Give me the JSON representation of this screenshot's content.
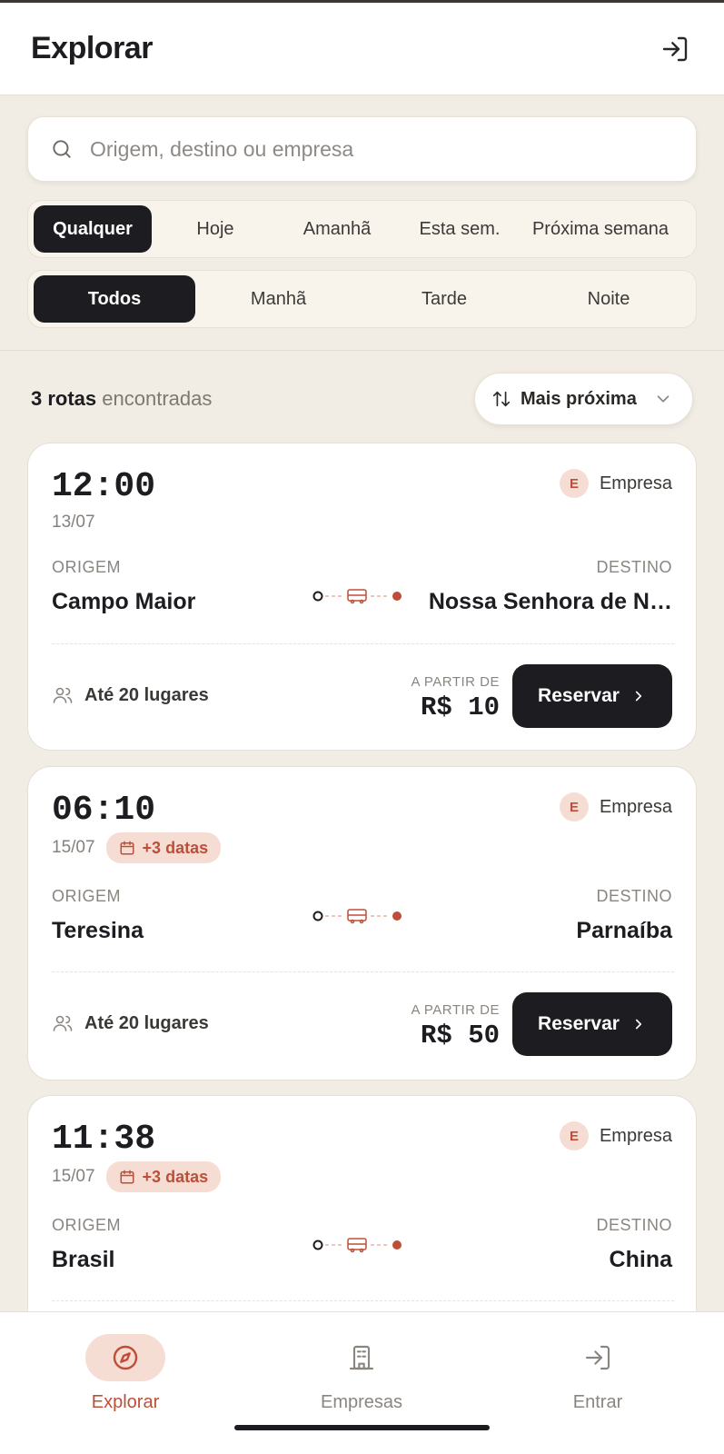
{
  "header": {
    "title": "Explorar",
    "login_icon": "login-icon"
  },
  "search": {
    "placeholder": "Origem, destino ou empresa",
    "icon": "search-icon"
  },
  "date_filter": {
    "options": [
      "Qualquer",
      "Hoje",
      "Amanhã",
      "Esta sem.",
      "Próxima semana"
    ],
    "active": "Qualquer"
  },
  "period_filter": {
    "options": [
      "Todos",
      "Manhã",
      "Tarde",
      "Noite"
    ],
    "active": "Todos"
  },
  "results": {
    "count": "3 rotas",
    "suffix": " encontradas"
  },
  "sort": {
    "label": "Mais próxima"
  },
  "labels": {
    "origin": "ORIGEM",
    "destination": "DESTINO",
    "from_price": "A PARTIR DE",
    "reserve": "Reservar"
  },
  "routes": [
    {
      "time": "12:00",
      "date": "13/07",
      "extra_dates": "",
      "company_initial": "E",
      "company": "Empresa",
      "origin": "Campo Maior",
      "destination": "Nossa Senhora de N…",
      "seats": "Até 20 lugares",
      "price": "R$ 10"
    },
    {
      "time": "06:10",
      "date": "15/07",
      "extra_dates": "+3 datas",
      "company_initial": "E",
      "company": "Empresa",
      "origin": "Teresina",
      "destination": "Parnaíba",
      "seats": "Até 20 lugares",
      "price": "R$ 50"
    },
    {
      "time": "11:38",
      "date": "15/07",
      "extra_dates": "+3 datas",
      "company_initial": "E",
      "company": "Empresa",
      "origin": "Brasil",
      "destination": "China",
      "seats": "",
      "price": ""
    }
  ],
  "bottom_nav": [
    {
      "label": "Explorar",
      "icon": "compass-icon",
      "active": true
    },
    {
      "label": "Empresas",
      "icon": "building-icon",
      "active": false
    },
    {
      "label": "Entrar",
      "icon": "login-icon",
      "active": false
    }
  ],
  "colors": {
    "accent": "#bf4e38",
    "accent_soft": "#f6ddd3",
    "dark": "#1d1c20",
    "background": "#f1ece4"
  }
}
